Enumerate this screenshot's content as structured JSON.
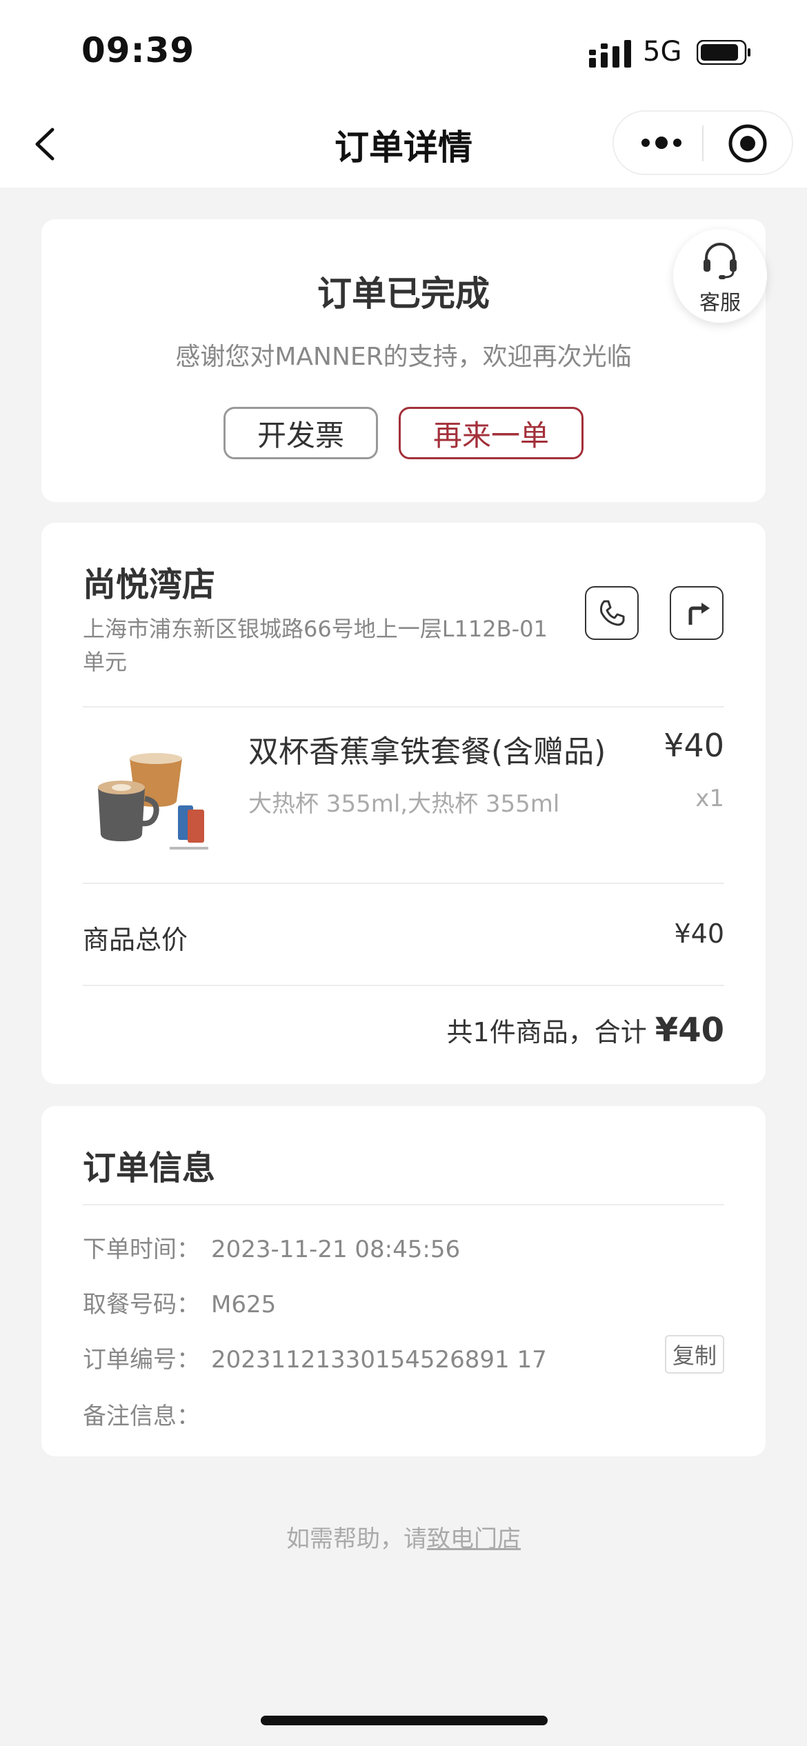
{
  "status_bar": {
    "time": "09:39",
    "network": "5G"
  },
  "nav": {
    "title": "订单详情"
  },
  "order_status": {
    "title": "订单已完成",
    "subtitle": "感谢您对MANNER的支持，欢迎再次光临",
    "invoice_label": "开发票",
    "reorder_label": "再来一单",
    "service_label": "客服"
  },
  "store": {
    "name": "尚悦湾店",
    "address": "上海市浦东新区银城路66号地上一层L112B-01单元"
  },
  "product": {
    "name": "双杯香蕉拿铁套餐(含赠品)",
    "price": "¥40",
    "spec": "大热杯 355ml,大热杯 355ml",
    "qty": "x1"
  },
  "totals": {
    "label": "商品总价",
    "value": "¥40",
    "summary": "共1件商品，合计",
    "amount": "¥40"
  },
  "order_info": {
    "title": "订单信息",
    "rows": [
      {
        "label": "下单时间：",
        "value": "2023-11-21 08:45:56"
      },
      {
        "label": "取餐号码：",
        "value": "M625"
      },
      {
        "label": "订单编号：",
        "value": "20231121330154526891 17"
      },
      {
        "label": "备注信息：",
        "value": ""
      }
    ],
    "copy_label": "复制"
  },
  "footer": {
    "help_prefix": "如需帮助，请",
    "help_link": "致电门店"
  },
  "colors": {
    "accent": "#a3303a",
    "background": "#f3f3f3"
  }
}
